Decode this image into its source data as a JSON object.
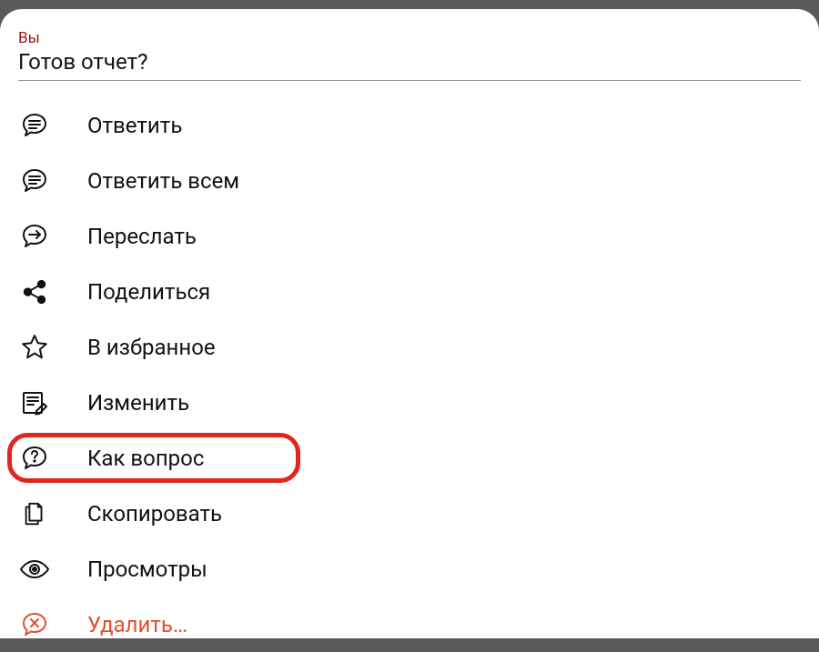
{
  "header": {
    "sender": "Вы",
    "message": "Готов отчет?"
  },
  "menu": {
    "reply": "Ответить",
    "reply_all": "Ответить всем",
    "forward": "Переслать",
    "share": "Поделиться",
    "favorite": "В избранное",
    "edit": "Изменить",
    "as_question": "Как вопрос",
    "copy": "Скопировать",
    "views": "Просмотры",
    "delete": "Удалить…"
  },
  "highlighted_item": "as_question"
}
